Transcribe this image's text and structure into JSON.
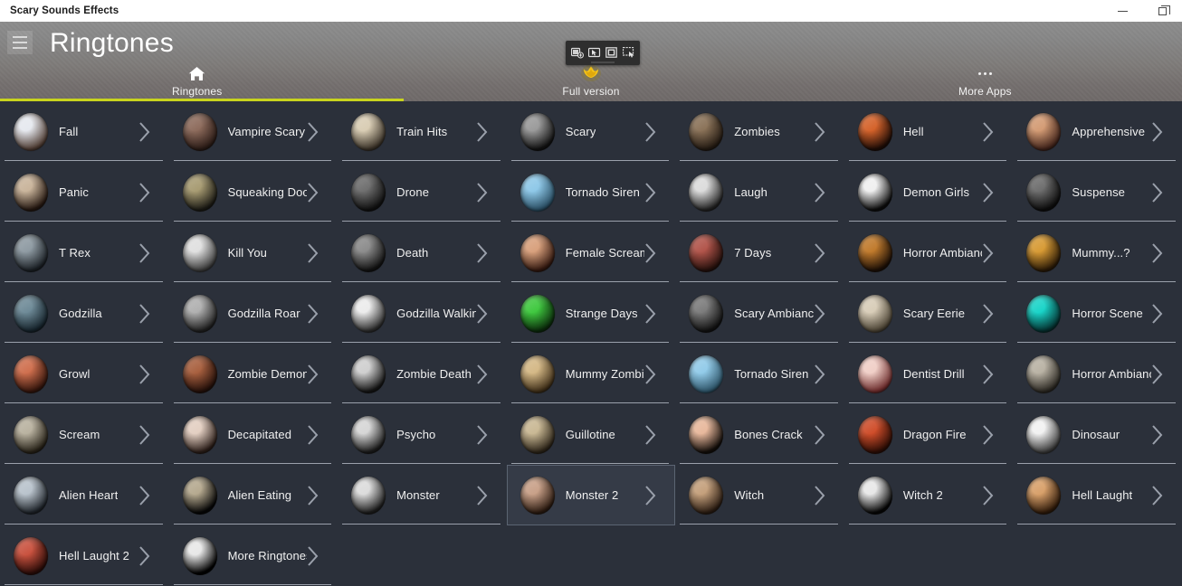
{
  "window": {
    "title": "Scary Sounds Effects",
    "controls": [
      {
        "name": "minimize-button",
        "glyph": "minimize"
      },
      {
        "name": "restore-button",
        "glyph": "restore"
      }
    ]
  },
  "capture_toolbar": {
    "icons": [
      {
        "name": "new-capture-icon",
        "label": "New capture"
      },
      {
        "name": "pointer-capture-icon",
        "label": "Pointer capture"
      },
      {
        "name": "region-capture-icon",
        "label": "Region capture"
      },
      {
        "name": "window-capture-icon",
        "label": "Window capture"
      }
    ]
  },
  "header": {
    "menu_icon": "hamburger-icon",
    "title": "Ringtones",
    "accent_color": "#c8d41e",
    "tabs": [
      {
        "id": "ringtones",
        "label": "Ringtones",
        "icon": "home-icon",
        "active": true
      },
      {
        "id": "full-version",
        "label": "Full version",
        "icon": "crown-icon",
        "active": false
      },
      {
        "id": "more-apps",
        "label": "More Apps",
        "icon": "ellipsis-icon",
        "active": false
      }
    ]
  },
  "list": {
    "selected_item": "Monster 2",
    "chevron_icon": "chevron-right-icon",
    "items": [
      {
        "label": "Fall",
        "c1": "#e6e9ef",
        "c2": "#4d3b32"
      },
      {
        "label": "Vampire Scary",
        "c1": "#8d6b5c",
        "c2": "#2a1b16"
      },
      {
        "label": "Train Hits",
        "c1": "#d9cdb4",
        "c2": "#3a3228"
      },
      {
        "label": "Scary",
        "c1": "#9a9a9a",
        "c2": "#111111"
      },
      {
        "label": "Zombies",
        "c1": "#8a7258",
        "c2": "#231a12"
      },
      {
        "label": "Hell",
        "c1": "#d4622a",
        "c2": "#1d0c06"
      },
      {
        "label": "Apprehensive",
        "c1": "#d39b74",
        "c2": "#40231a"
      },
      {
        "label": "Panic",
        "c1": "#c9b49b",
        "c2": "#241710"
      },
      {
        "label": "Squeaking Door",
        "c1": "#a79b72",
        "c2": "#1b1a14"
      },
      {
        "label": "Drone",
        "c1": "#6e6e6e",
        "c2": "#101010"
      },
      {
        "label": "Tornado Siren",
        "c1": "#8ec8e8",
        "c2": "#2a4e63"
      },
      {
        "label": "Laugh",
        "c1": "#dcdcdc",
        "c2": "#222222"
      },
      {
        "label": "Demon Girls",
        "c1": "#f0f0f0",
        "c2": "#0b0b0b"
      },
      {
        "label": "Suspense",
        "c1": "#6d6d6d",
        "c2": "#0c0c0c"
      },
      {
        "label": "T Rex",
        "c1": "#8e9aa2",
        "c2": "#1a1f24"
      },
      {
        "label": "Kill You",
        "c1": "#e0e0e0",
        "c2": "#3b3b3b"
      },
      {
        "label": "Death",
        "c1": "#8b8b8b",
        "c2": "#121212"
      },
      {
        "label": "Female Scream",
        "c1": "#d8a07c",
        "c2": "#32180f"
      },
      {
        "label": "7 Days",
        "c1": "#b1544a",
        "c2": "#24100c"
      },
      {
        "label": "Horror Ambiance",
        "c1": "#c07a2c",
        "c2": "#1c0f06"
      },
      {
        "label": "Mummy...?",
        "c1": "#d79a34",
        "c2": "#2a1a07"
      },
      {
        "label": "Godzilla",
        "c1": "#6e8a97",
        "c2": "#15222a"
      },
      {
        "label": "Godzilla Roar",
        "c1": "#b0b0b0",
        "c2": "#1f1f1f"
      },
      {
        "label": "Godzilla Walking",
        "c1": "#ececec",
        "c2": "#2c2c2c"
      },
      {
        "label": "Strange Days",
        "c1": "#3fc83f",
        "c2": "#0b2a0b"
      },
      {
        "label": "Scary Ambiance",
        "c1": "#7c7c7c",
        "c2": "#111111"
      },
      {
        "label": "Scary Eerie",
        "c1": "#d8cdb8",
        "c2": "#4a4233"
      },
      {
        "label": "Horror Scene",
        "c1": "#19d4c8",
        "c2": "#05302f"
      },
      {
        "label": "Growl",
        "c1": "#cf6f4e",
        "c2": "#33150c"
      },
      {
        "label": "Zombie Demon",
        "c1": "#a8603f",
        "c2": "#24100a"
      },
      {
        "label": "Zombie Death",
        "c1": "#cfcfcf",
        "c2": "#141414"
      },
      {
        "label": "Mummy Zombie",
        "c1": "#d4b886",
        "c2": "#3e2e18"
      },
      {
        "label": "Tornado Siren",
        "c1": "#92cbe9",
        "c2": "#2e5468"
      },
      {
        "label": "Dentist Drill",
        "c1": "#f0cfc7",
        "c2": "#6b2b2b"
      },
      {
        "label": "Horror Ambiance",
        "c1": "#b9b2a4",
        "c2": "#2b2822"
      },
      {
        "label": "Scream",
        "c1": "#b9b2a0",
        "c2": "#262117"
      },
      {
        "label": "Decapitated",
        "c1": "#e3cfc2",
        "c2": "#2a1d18"
      },
      {
        "label": "Psycho",
        "c1": "#d6d6d6",
        "c2": "#1a1a1a"
      },
      {
        "label": "Guillotine",
        "c1": "#c9b894",
        "c2": "#2c2418"
      },
      {
        "label": "Bones Crack",
        "c1": "#e8b89c",
        "c2": "#120d09"
      },
      {
        "label": "Dragon Fire",
        "c1": "#cf4d2a",
        "c2": "#2c0d05"
      },
      {
        "label": "Dinosaur",
        "c1": "#f2f2f2",
        "c2": "#3a3a3a"
      },
      {
        "label": "Alien Heart",
        "c1": "#b9c3cc",
        "c2": "#1d2228"
      },
      {
        "label": "Alien Eating",
        "c1": "#b5a98f",
        "c2": "#050505"
      },
      {
        "label": "Monster",
        "c1": "#dcdcdc",
        "c2": "#1c1c1c"
      },
      {
        "label": "Monster 2",
        "c1": "#c8a088",
        "c2": "#2a1a10"
      },
      {
        "label": "Witch",
        "c1": "#c4a07c",
        "c2": "#2a1c12"
      },
      {
        "label": "Witch 2",
        "c1": "#e8e8e8",
        "c2": "#050505"
      },
      {
        "label": "Hell Laught",
        "c1": "#d8a06a",
        "c2": "#2e1a0a"
      },
      {
        "label": "Hell Laught 2",
        "c1": "#c9523f",
        "c2": "#2a0c08"
      },
      {
        "label": "More Ringtones",
        "c1": "#e8e8e8",
        "c2": "#000000"
      }
    ]
  }
}
